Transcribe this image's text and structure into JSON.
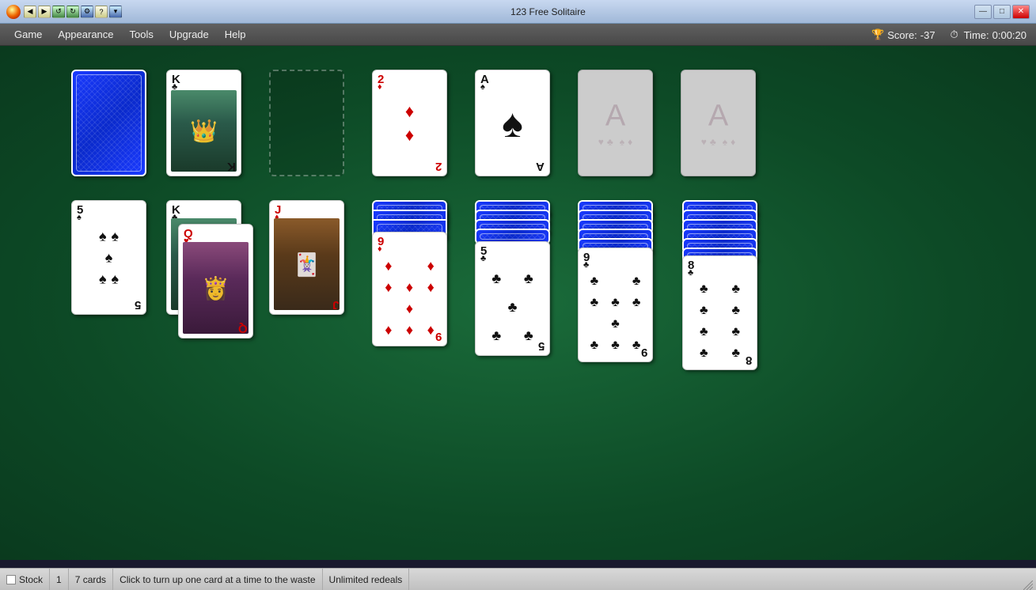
{
  "window": {
    "title": "123 Free Solitaire",
    "min_label": "—",
    "max_label": "□",
    "close_label": "✕"
  },
  "toolbar": {
    "buttons": [
      "◀",
      "▶",
      "↺",
      "↻",
      "⚙",
      "?",
      "▾"
    ]
  },
  "menu": {
    "items": [
      "Game",
      "Appearance",
      "Tools",
      "Upgrade",
      "Help"
    ]
  },
  "score": {
    "label": "Score:",
    "value": "-37",
    "time_label": "Time:",
    "time_value": "0:00:20"
  },
  "status": {
    "stock_label": "Stock",
    "count": "1",
    "cards": "7 cards",
    "hint": "Click to turn up one card at a time to the waste",
    "redeals": "Unlimited redeals"
  }
}
